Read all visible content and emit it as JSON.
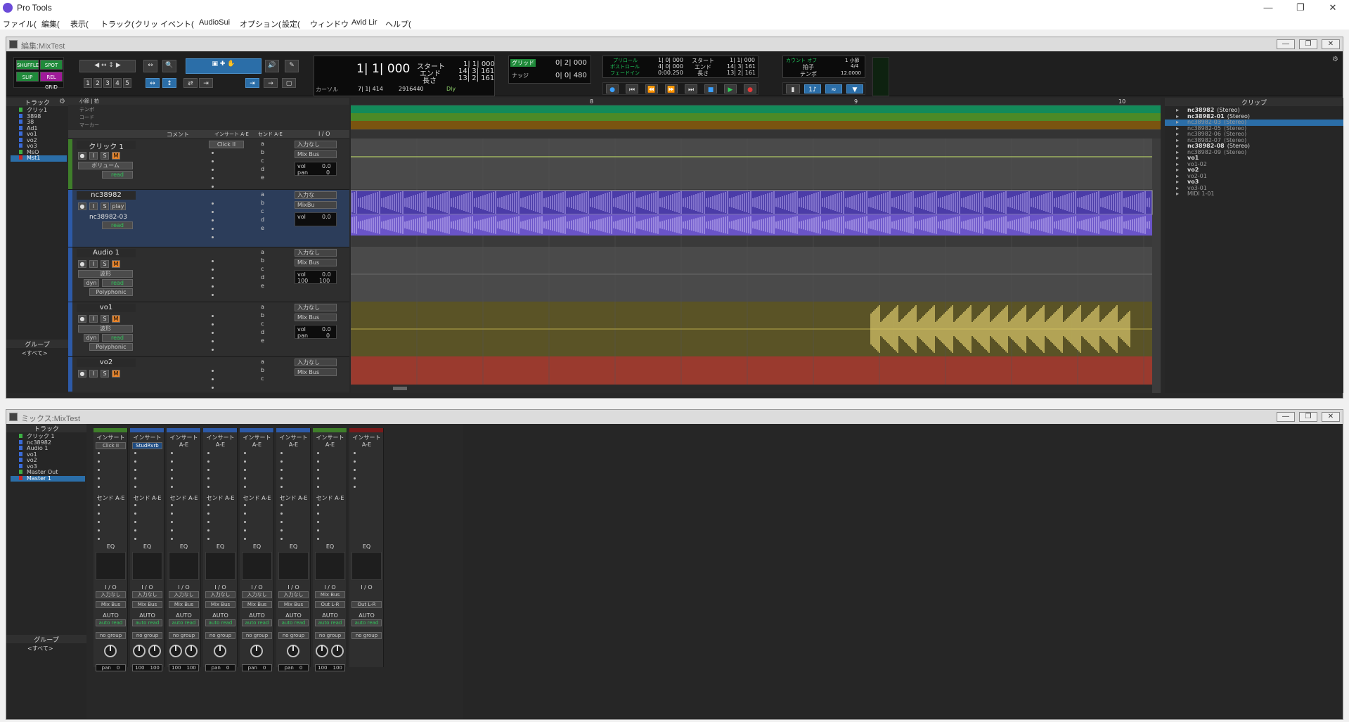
{
  "app": {
    "title": "Pro Tools"
  },
  "menu": [
    "ファイル(",
    "編集(",
    "表示(",
    "トラック(",
    "クリッ",
    "イベント(",
    "AudioSui",
    "オプション(",
    "設定(",
    "ウィンドウ",
    "Avid Lir",
    "ヘルプ("
  ],
  "edit_window": {
    "title": "編集:MixTest",
    "modes": {
      "shuffle": "SHUFFLE",
      "spot": "SPOT",
      "slip": "SLIP",
      "grid": "REL GRID"
    },
    "zoom_presets": [
      "1",
      "2",
      "3",
      "4",
      "5"
    ],
    "main_counter": "1| 1| 000",
    "start_label": "スタート",
    "end_label": "エンド",
    "length_label": "長さ",
    "start_val": "1| 1| 000",
    "end_val": "14| 3| 161",
    "length_val": "13| 2| 161",
    "cursor_label": "カーソル",
    "cursor_val": "7| 1| 414",
    "cursor_sample": "2916440",
    "dly_label": "Dly",
    "grid_label": "グリッド",
    "grid_val": "0| 2| 000",
    "nudge_label": "ナッジ",
    "nudge_val": "0| 0| 480",
    "preroll_label": "プリロール",
    "postroll_label": "ポストロール",
    "fade_label": "フェードイン",
    "preroll_val": "1| 0| 000",
    "postroll_val": "4| 0| 000",
    "fade_val": "0:00.250",
    "rec_start_label": "スタート",
    "rec_end_label": "エンド",
    "rec_len_label": "長さ",
    "rec_start_val": "1| 1| 000",
    "rec_end_val": "14| 3| 161",
    "rec_len_val": "13| 2| 161",
    "countoff_label": "カウント オフ",
    "countoff_val": "1 小節",
    "meter_label": "拍子",
    "meter_val": "4/4",
    "tempo_label": "テンポ",
    "tempo_val": "12.0000",
    "track_panel_title": "トラック",
    "track_list": [
      {
        "name": "クリッ1",
        "color": "#3cb043"
      },
      {
        "name": "3898",
        "color": "#3a6bd8"
      },
      {
        "name": "38",
        "color": "#3a6bd8"
      },
      {
        "name": "Ad1",
        "color": "#3a6bd8"
      },
      {
        "name": "vo1",
        "color": "#3a6bd8"
      },
      {
        "name": "vo2",
        "color": "#3a6bd8"
      },
      {
        "name": "vo3",
        "color": "#3a6bd8"
      },
      {
        "name": "MsO",
        "color": "#3cb043"
      },
      {
        "name": "Mst1",
        "color": "#c62828"
      }
    ],
    "group_panel_title": "グループ",
    "group_all": "<すべて>",
    "ruler_label": "小節 | 拍",
    "ruler_rows": [
      "テンポ",
      "コード",
      "マーカー"
    ],
    "ruler_marks": [
      "8",
      "9",
      "10"
    ],
    "column_headers": [
      "コメント",
      "インサート A-E",
      "センド A-E",
      "I / O"
    ],
    "clips_title": "クリップ",
    "clips": [
      {
        "name": "nc38982",
        "suffix": "(Stereo)",
        "bold": true
      },
      {
        "name": "nc38982-01",
        "suffix": "(Stereo)",
        "bold": true
      },
      {
        "name": "nc38982-03",
        "suffix": "(Stereo)",
        "bold": false,
        "selected": true
      },
      {
        "name": "nc38982-05",
        "suffix": "(Stereo)",
        "bold": false
      },
      {
        "name": "nc38982-06",
        "suffix": "(Stereo)",
        "bold": false
      },
      {
        "name": "nc38982-07",
        "suffix": "(Stereo)",
        "bold": false
      },
      {
        "name": "nc38982-08",
        "suffix": "(Stereo)",
        "bold": true
      },
      {
        "name": "nc38982-09",
        "suffix": "(Stereo)",
        "bold": false
      },
      {
        "name": "vo1",
        "suffix": "",
        "bold": true
      },
      {
        "name": "vo1-02",
        "suffix": "",
        "bold": false
      },
      {
        "name": "vo2",
        "suffix": "",
        "bold": true
      },
      {
        "name": "vo2-01",
        "suffix": "",
        "bold": false
      },
      {
        "name": "vo3",
        "suffix": "",
        "bold": true
      },
      {
        "name": "vo3-01",
        "suffix": "",
        "bold": false
      },
      {
        "name": "MIDI 1-01",
        "suffix": "",
        "bold": false
      }
    ],
    "tracks": [
      {
        "name": "クリック 1",
        "view": "ボリューム",
        "insert": "Click II",
        "input": "入力なし",
        "output": "Mix Bus",
        "vol": "0.0",
        "pan": "0",
        "auto": "read"
      },
      {
        "name": "nc38982",
        "clip": "nc38982-03",
        "input": "入力な",
        "output": "MixBu",
        "vol": "0.0",
        "play": "play",
        "auto": "read"
      },
      {
        "name": "Audio 1",
        "view": "波形",
        "input": "入力なし",
        "output": "Mix Bus",
        "vol": "0.0",
        "pan_l": "100",
        "pan_r": "100",
        "voice": "Polyphonic",
        "dyn": "dyn",
        "auto": "read"
      },
      {
        "name": "vo1",
        "view": "波形",
        "input": "入力なし",
        "output": "Mix Bus",
        "vol": "0.0",
        "pan": "0",
        "voice": "Polyphonic",
        "dyn": "dyn",
        "auto": "read"
      },
      {
        "name": "vo2",
        "input": "入力なし",
        "output": "Mix Bus"
      }
    ],
    "send_letters": [
      "a",
      "b",
      "c",
      "d",
      "e"
    ]
  },
  "mix_window": {
    "title": "ミックス:MixTest",
    "track_panel_title": "トラック",
    "track_list": [
      {
        "name": "クリック 1",
        "color": "#3cb043"
      },
      {
        "name": "nc38982",
        "color": "#3a6bd8"
      },
      {
        "name": "Audio 1",
        "color": "#3a6bd8"
      },
      {
        "name": "vo1",
        "color": "#3a6bd8"
      },
      {
        "name": "vo2",
        "color": "#3a6bd8"
      },
      {
        "name": "vo3",
        "color": "#3a6bd8"
      },
      {
        "name": "Master Out",
        "color": "#3cb043"
      },
      {
        "name": "Master 1",
        "color": "#c62828"
      }
    ],
    "group_panel_title": "グループ",
    "group_all": "<すべて>",
    "inserts_label": "インサート A-E",
    "sends_label": "センド A-E",
    "eq_label": "EQ",
    "io_label": "I / O",
    "auto_label": "AUTO",
    "group_label": "no group",
    "strips": [
      {
        "color": "#3f7f2a",
        "insert": "Click II",
        "input": "入力なし",
        "output": "Mix Bus",
        "auto": "auto read",
        "pan": "pan",
        "panval": "0",
        "stereo": false
      },
      {
        "color": "#2d5aa8",
        "insert": "StudRvrb",
        "input": "入力なし",
        "output": "Mix Bus",
        "auto": "auto read",
        "pan": "100",
        "panval": "100",
        "stereo": true
      },
      {
        "color": "#2d5aa8",
        "insert": "",
        "input": "入力なし",
        "output": "Mix Bus",
        "auto": "auto read",
        "pan": "100",
        "panval": "100",
        "stereo": true
      },
      {
        "color": "#2d5aa8",
        "insert": "",
        "input": "入力なし",
        "output": "Mix Bus",
        "auto": "auto read",
        "pan": "pan",
        "panval": "0",
        "stereo": false
      },
      {
        "color": "#2d5aa8",
        "insert": "",
        "input": "入力なし",
        "output": "Mix Bus",
        "auto": "auto read",
        "pan": "pan",
        "panval": "0",
        "stereo": false
      },
      {
        "color": "#2d5aa8",
        "insert": "",
        "input": "入力なし",
        "output": "Mix Bus",
        "auto": "auto read",
        "pan": "pan",
        "panval": "0",
        "stereo": false
      },
      {
        "color": "#3f7f2a",
        "insert": "",
        "input": "Mix Bus",
        "output": "Out L-R",
        "auto": "auto read",
        "pan": "100",
        "panval": "100",
        "stereo": true
      },
      {
        "color": "#7a1a1a",
        "insert": "",
        "input": "",
        "output": "Out L-R",
        "auto": "auto read",
        "pan": "",
        "panval": "",
        "stereo": false
      }
    ]
  }
}
